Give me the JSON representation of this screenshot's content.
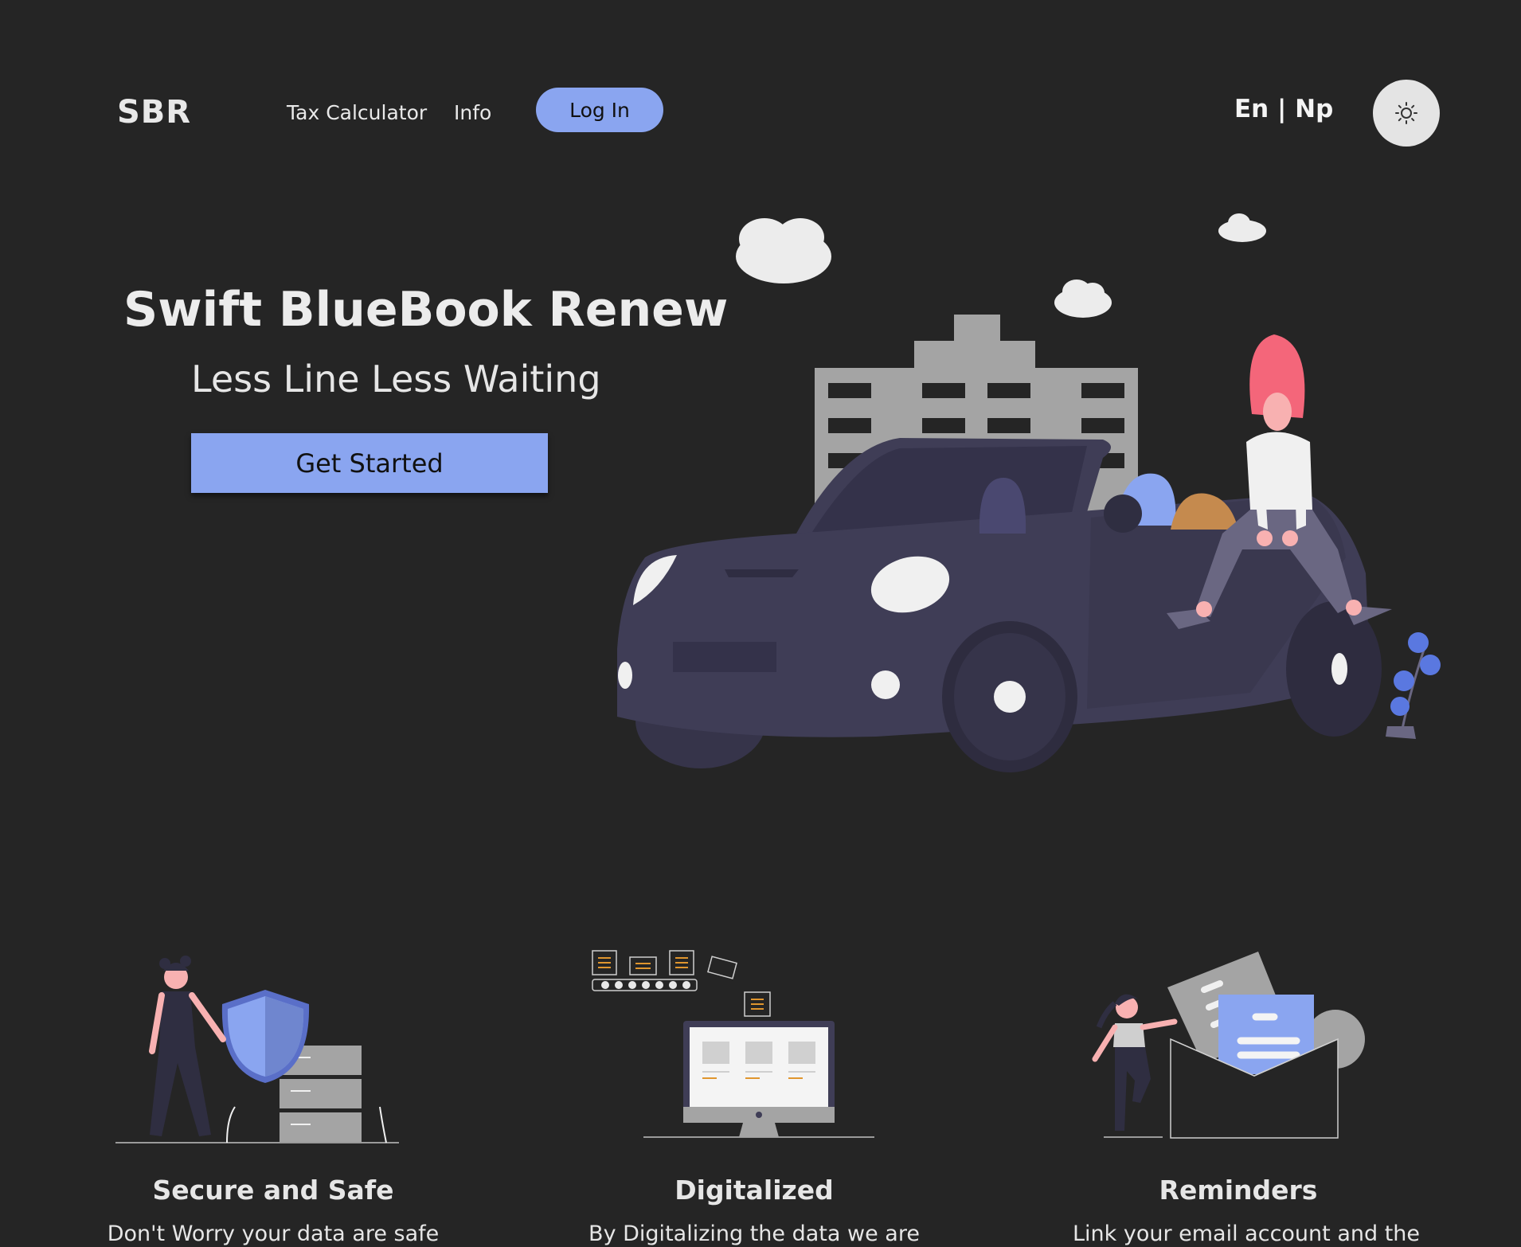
{
  "header": {
    "logo": "SBR",
    "nav": [
      {
        "label": "Tax Calculator"
      },
      {
        "label": "Info"
      }
    ],
    "login_label": "Log In",
    "lang_label": "En | Np",
    "theme_icon": "sun-icon"
  },
  "hero": {
    "title": "Swift BlueBook Renew",
    "subtitle": "Less Line Less Waiting",
    "cta_label": "Get Started",
    "illustration": "car-with-woman-illustration"
  },
  "features": [
    {
      "title": "Secure and Safe",
      "text": "Don't Worry your data are safe",
      "icon": "shield-server-illustration"
    },
    {
      "title": "Digitalized",
      "text": "By Digitalizing the data we are",
      "icon": "computer-documents-illustration"
    },
    {
      "title": "Reminders",
      "text": "Link your email account and the",
      "icon": "envelope-illustration"
    }
  ],
  "colors": {
    "background": "#252525",
    "accent": "#8aa5f0",
    "car": "#3f3d56",
    "building": "#a4a4a4",
    "hair": "#f4667a"
  }
}
